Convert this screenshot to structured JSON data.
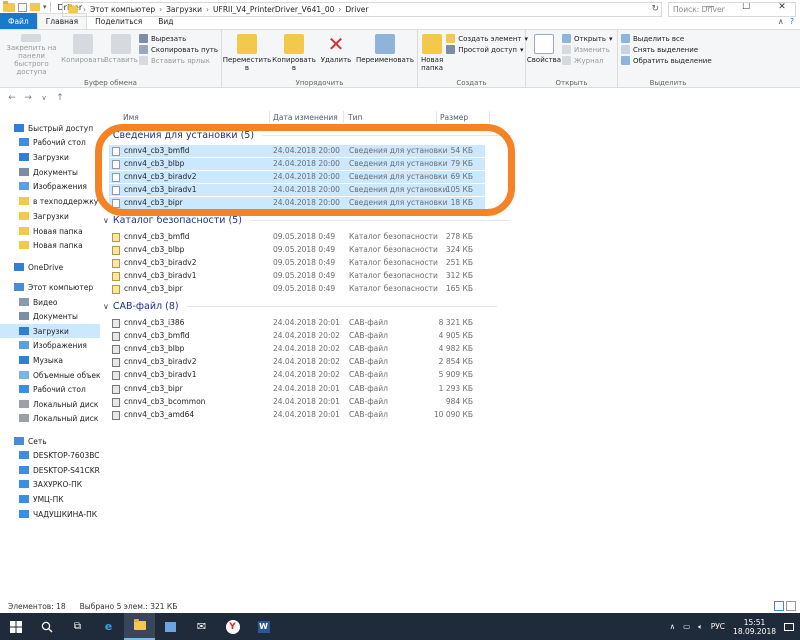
{
  "window": {
    "title": "Driver"
  },
  "tabs": [
    "Файл",
    "Главная",
    "Поделиться",
    "Вид"
  ],
  "ribbon": {
    "clipboard": {
      "name": "Буфер обмена",
      "pin": "Закрепить на панели быстрого доступа",
      "copy": "Копировать",
      "paste": "Вставить",
      "cut": "Вырезать",
      "copy_path": "Скопировать путь",
      "paste_shortcut": "Вставить ярлык"
    },
    "organize": {
      "name": "Упорядочить",
      "move_to": "Переместить в",
      "copy_to": "Копировать в",
      "delete": "Удалить",
      "rename": "Переименовать"
    },
    "create": {
      "name": "Создать",
      "new_folder": "Новая папка",
      "new_item": "Создать элемент",
      "easy_access": "Простой доступ"
    },
    "open": {
      "name": "Открыть",
      "properties": "Свойства",
      "open": "Открыть",
      "edit": "Изменить",
      "history": "Журнал"
    },
    "select": {
      "name": "Выделить",
      "select_all": "Выделить все",
      "select_none": "Снять выделение",
      "invert": "Обратить выделение"
    }
  },
  "address": {
    "crumbs": [
      "Этот компьютер",
      "Загрузки",
      "UFRII_V4_PrinterDriver_V641_00",
      "Driver"
    ],
    "search_placeholder": "Поиск: Driver"
  },
  "sidebar": [
    {
      "label": "Быстрый доступ",
      "icon": "star-icon",
      "level": 0
    },
    {
      "label": "Рабочий стол",
      "icon": "desktop-icon",
      "level": 1
    },
    {
      "label": "Загрузки",
      "icon": "download-icon",
      "level": 1
    },
    {
      "label": "Документы",
      "icon": "documents-icon",
      "level": 1
    },
    {
      "label": "Изображения",
      "icon": "pictures-icon",
      "level": 1
    },
    {
      "label": "в техподдержку Са",
      "icon": "folder-icon",
      "level": 1
    },
    {
      "label": "Загрузки",
      "icon": "folder-icon",
      "level": 1
    },
    {
      "label": "Новая папка",
      "icon": "folder-icon",
      "level": 1
    },
    {
      "label": "Новая папка",
      "icon": "folder-icon",
      "level": 1
    },
    {
      "label": "OneDrive",
      "icon": "cloud-icon",
      "level": 0
    },
    {
      "label": "Этот компьютер",
      "icon": "computer-icon",
      "level": 0
    },
    {
      "label": "Видео",
      "icon": "video-icon",
      "level": 1
    },
    {
      "label": "Документы",
      "icon": "documents-icon",
      "level": 1
    },
    {
      "label": "Загрузки",
      "icon": "download-icon",
      "level": 1
    },
    {
      "label": "Изображения",
      "icon": "pictures-icon",
      "level": 1
    },
    {
      "label": "Музыка",
      "icon": "music-icon",
      "level": 1
    },
    {
      "label": "Объемные объекть",
      "icon": "3d-objects-icon",
      "level": 1
    },
    {
      "label": "Рабочий стол",
      "icon": "desktop-icon",
      "level": 1
    },
    {
      "label": "Локальный диск (С",
      "icon": "drive-icon",
      "level": 1
    },
    {
      "label": "Локальный диск (E",
      "icon": "drive-icon",
      "level": 1
    },
    {
      "label": "Сеть",
      "icon": "network-icon",
      "level": 0
    },
    {
      "label": "DESKTOP-7603BC5",
      "icon": "pc-icon",
      "level": 1
    },
    {
      "label": "DESKTOP-S41CKRD",
      "icon": "pc-icon",
      "level": 1
    },
    {
      "label": "ЗАХУРКО-ПК",
      "icon": "pc-icon",
      "level": 1
    },
    {
      "label": "УМЦ-ПК",
      "icon": "pc-icon",
      "level": 1
    },
    {
      "label": "ЧАДУШКИНА-ПК",
      "icon": "pc-icon",
      "level": 1
    }
  ],
  "columns": {
    "name": "Имя",
    "date": "Дата изменения",
    "type": "Тип",
    "size": "Размер"
  },
  "groups": [
    {
      "label": "Сведения для установки (5)",
      "icon": "inf-file-icon",
      "files": [
        {
          "name": "cnnv4_cb3_bmfld",
          "date": "24.04.2018 20:00",
          "type": "Сведения для установки",
          "size": "54 КБ",
          "selected": true
        },
        {
          "name": "cnnv4_cb3_blbp",
          "date": "24.04.2018 20:00",
          "type": "Сведения для установки",
          "size": "79 КБ",
          "selected": true
        },
        {
          "name": "cnnv4_cb3_biradv2",
          "date": "24.04.2018 20:00",
          "type": "Сведения для установки",
          "size": "69 КБ",
          "selected": true
        },
        {
          "name": "cnnv4_cb3_biradv1",
          "date": "24.04.2018 20:00",
          "type": "Сведения для установки",
          "size": "105 КБ",
          "selected": true
        },
        {
          "name": "cnnv4_cb3_bipr",
          "date": "24.04.2018 20:00",
          "type": "Сведения для установки",
          "size": "18 КБ",
          "selected": true
        }
      ]
    },
    {
      "label": "Каталог безопасности (5)",
      "icon": "catalog-file-icon",
      "files": [
        {
          "name": "cnnv4_cb3_bmfld",
          "date": "09.05.2018 0:49",
          "type": "Каталог безопасности",
          "size": "278 КБ",
          "selected": false
        },
        {
          "name": "cnnv4_cb3_blbp",
          "date": "09.05.2018 0:49",
          "type": "Каталог безопасности",
          "size": "324 КБ",
          "selected": false
        },
        {
          "name": "cnnv4_cb3_biradv2",
          "date": "09.05.2018 0:49",
          "type": "Каталог безопасности",
          "size": "251 КБ",
          "selected": false
        },
        {
          "name": "cnnv4_cb3_biradv1",
          "date": "09.05.2018 0:49",
          "type": "Каталог безопасности",
          "size": "312 КБ",
          "selected": false
        },
        {
          "name": "cnnv4_cb3_bipr",
          "date": "09.05.2018 0:49",
          "type": "Каталог безопасности",
          "size": "165 КБ",
          "selected": false
        }
      ]
    },
    {
      "label": "CAB-файл (8)",
      "icon": "cab-file-icon",
      "files": [
        {
          "name": "cnnv4_cb3_i386",
          "date": "24.04.2018 20:01",
          "type": "CAB-файл",
          "size": "8 321 КБ",
          "selected": false
        },
        {
          "name": "cnnv4_cb3_bmfld",
          "date": "24.04.2018 20:02",
          "type": "CAB-файл",
          "size": "4 905 КБ",
          "selected": false
        },
        {
          "name": "cnnv4_cb3_blbp",
          "date": "24.04.2018 20:02",
          "type": "CAB-файл",
          "size": "4 982 КБ",
          "selected": false
        },
        {
          "name": "cnnv4_cb3_biradv2",
          "date": "24.04.2018 20:02",
          "type": "CAB-файл",
          "size": "2 854 КБ",
          "selected": false
        },
        {
          "name": "cnnv4_cb3_biradv1",
          "date": "24.04.2018 20:02",
          "type": "CAB-файл",
          "size": "5 909 КБ",
          "selected": false
        },
        {
          "name": "cnnv4_cb3_bipr",
          "date": "24.04.2018 20:01",
          "type": "CAB-файл",
          "size": "1 293 КБ",
          "selected": false
        },
        {
          "name": "cnnv4_cb3_bcommon",
          "date": "24.04.2018 20:01",
          "type": "CAB-файл",
          "size": "984 КБ",
          "selected": false
        },
        {
          "name": "cnnv4_cb3_amd64",
          "date": "24.04.2018 20:01",
          "type": "CAB-файл",
          "size": "10 090 КБ",
          "selected": false
        }
      ]
    }
  ],
  "status": {
    "items": "Элементов: 18",
    "selected": "Выбрано 5 элем.: 321 КБ"
  },
  "taskbar": {
    "lang": "РУС",
    "time": "15:51",
    "date": "18.09.2018"
  },
  "colors": {
    "accent": "#1979ca",
    "selection": "#cce8ff",
    "highlight": "#f58225",
    "taskbar": "#1f2a3a"
  }
}
